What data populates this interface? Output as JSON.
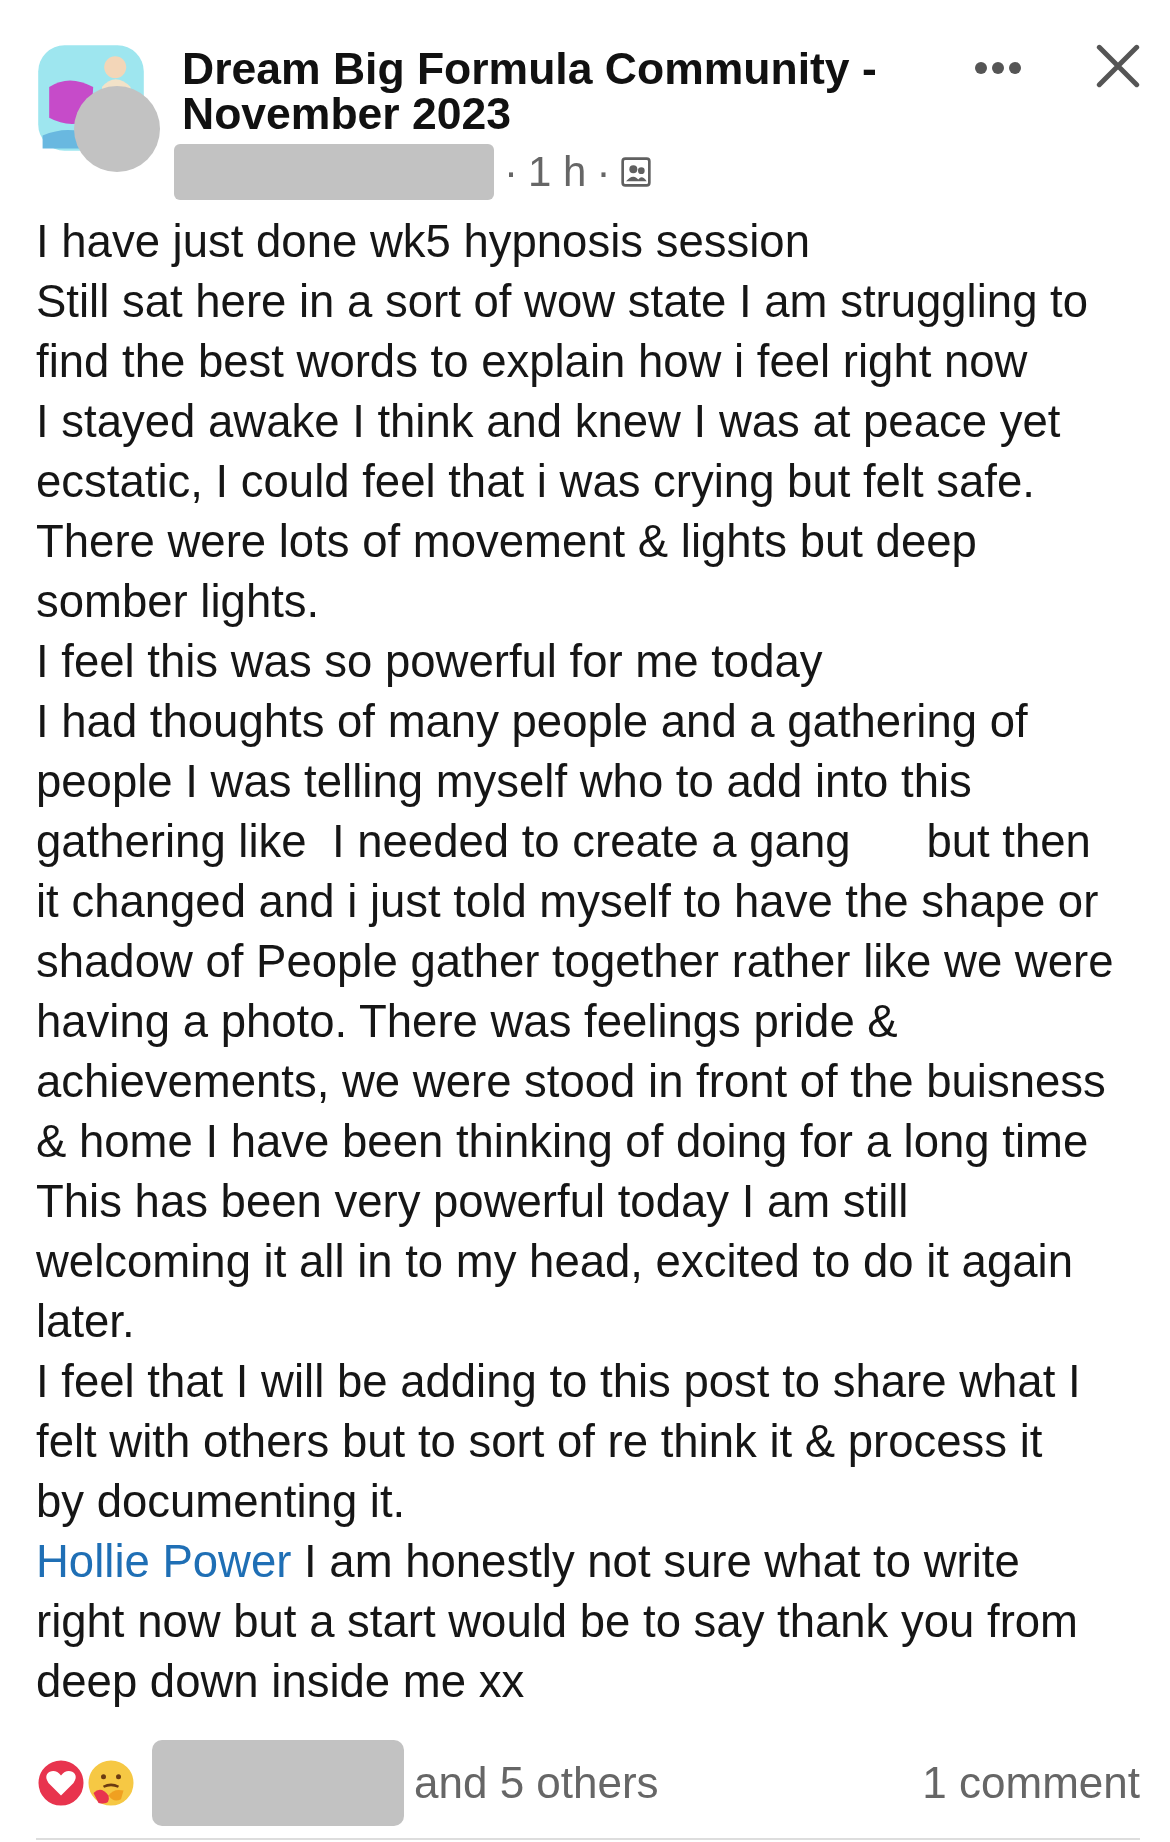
{
  "post": {
    "group_name": "Dream Big Formula Community - November 2023",
    "meta": [
      "·",
      "1 h",
      "·"
    ],
    "lines": [
      {
        "text": "I have just done wk5 hypnosis session"
      },
      {
        "text": "Still sat here in a sort of wow state I am struggling to"
      },
      {
        "text": "find the best words to explain how i feel right now"
      },
      {
        "text": "I stayed awake I think and knew I was at peace yet"
      },
      {
        "text": "ecstatic, I could feel that i was crying but felt safe."
      },
      {
        "text": "There were lots of movement & lights but deep"
      },
      {
        "text": "somber lights."
      },
      {
        "text": "I feel this was so powerful for me today"
      },
      {
        "text": "I had thoughts of many people and a gathering of"
      },
      {
        "text": "people I was telling myself who to add into this"
      },
      {
        "text": "gathering like  I needed to create a gang      but then"
      },
      {
        "text": "it changed and i just told myself to have the shape or"
      },
      {
        "text": "shadow of People gather together rather like we were"
      },
      {
        "text": "having a photo. There was feelings pride &"
      },
      {
        "text": "achievements, we were stood in front of the buisness"
      },
      {
        "text": "& home I have been thinking of doing for a long time"
      },
      {
        "text": "This has been very powerful today I am still"
      },
      {
        "text": "welcoming it all in to my head, excited to do it again"
      },
      {
        "text": "later."
      },
      {
        "text": "I feel that I will be adding to this post to share what I"
      },
      {
        "text": "felt with others but to sort of re think it & process it"
      },
      {
        "text": "by documenting it."
      },
      {
        "mention": "Hollie Power",
        "text": " I am honestly not sure what to write"
      },
      {
        "text": "right now but a start would be to say thank you from"
      },
      {
        "text": "deep down inside me xx"
      }
    ],
    "reactions_others": "and 5 others",
    "comments": "1 comment"
  }
}
